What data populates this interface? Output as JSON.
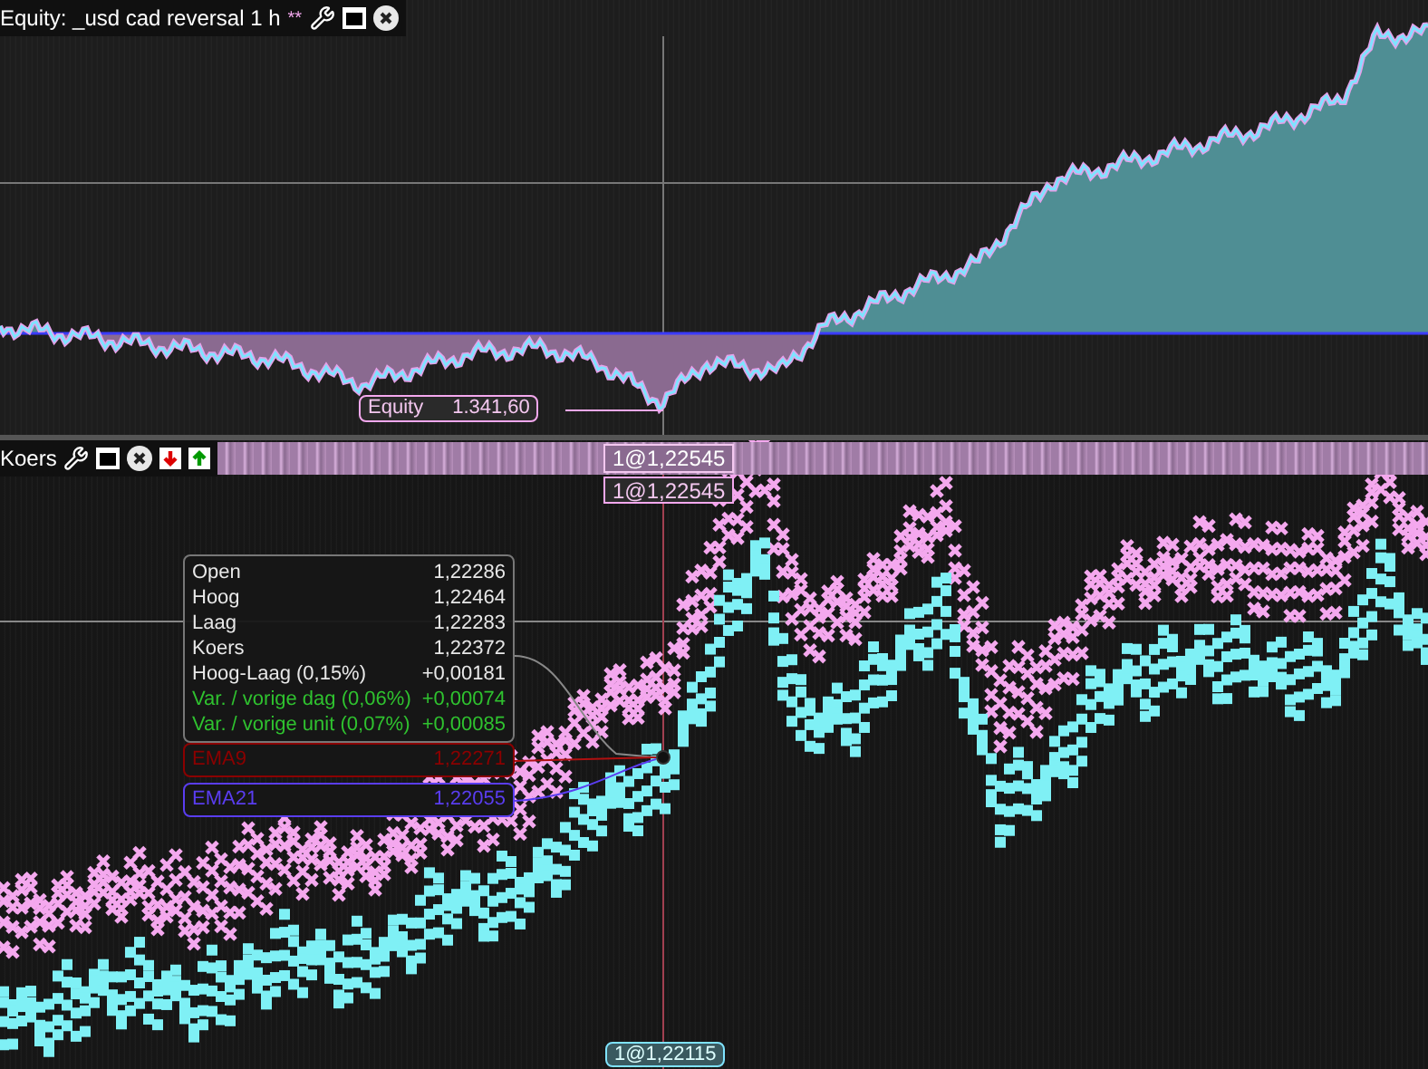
{
  "equity_panel": {
    "title": "Equity: _usd cad reversal 1 h",
    "modified_mark": "**",
    "value_label": {
      "name": "Equity",
      "value": "1.341,60"
    }
  },
  "price_panel": {
    "title": "Koers",
    "cursor_top_label": "1@1,22545",
    "cursor_price_label": "1@1,22545",
    "cursor_bottom_label": "1@1,22115",
    "tooltip": {
      "rows": [
        {
          "label": "Open",
          "value": "1,22286",
          "kind": "plain"
        },
        {
          "label": "Hoog",
          "value": "1,22464",
          "kind": "plain"
        },
        {
          "label": "Laag",
          "value": "1,22283",
          "kind": "plain"
        },
        {
          "label": "Koers",
          "value": "1,22372",
          "kind": "plain"
        },
        {
          "label": "Hoog-Laag (0,15%)",
          "value": "+0,00181",
          "kind": "plain"
        },
        {
          "label": "Var. / vorige dag (0,06%)",
          "value": "+0,00074",
          "kind": "change"
        },
        {
          "label": "Var. / vorige unit (0,07%)",
          "value": "+0,00085",
          "kind": "change"
        }
      ]
    },
    "indicators": [
      {
        "name": "EMA9",
        "value": "1,22271",
        "color": "#8b0000"
      },
      {
        "name": "EMA21",
        "value": "1,22055",
        "color": "#5a3df0"
      }
    ]
  }
}
